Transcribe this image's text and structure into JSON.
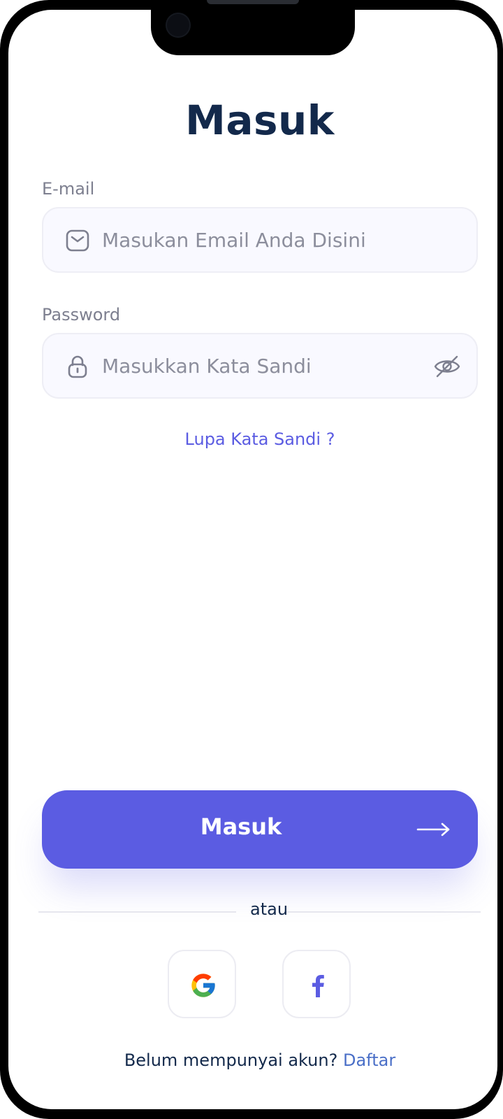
{
  "screen": {
    "title": "Masuk"
  },
  "email": {
    "label": "E-mail",
    "value": "",
    "placeholder": "Masukan Email Anda Disini",
    "icon": "mail-icon"
  },
  "password": {
    "label": "Password",
    "value": "",
    "placeholder": "Masukkan Kata Sandi",
    "icon": "lock-icon",
    "toggle_icon": "eye-off-icon"
  },
  "forgot_password": "Lupa Kata Sandi ?",
  "submit": {
    "label": "Masuk",
    "icon": "arrow-right-icon"
  },
  "divider_text": "atau",
  "social": [
    {
      "provider_icon": "google-icon"
    },
    {
      "provider_icon": "facebook-icon"
    }
  ],
  "signup": {
    "prompt": "Belum mempunyai akun?",
    "link": "Daftar"
  },
  "colors": {
    "primary": "#5b5ce2",
    "title": "#13294b",
    "link": "#4a6fc7",
    "input_bg": "#f9f9ff",
    "muted": "#7d7f8f"
  }
}
